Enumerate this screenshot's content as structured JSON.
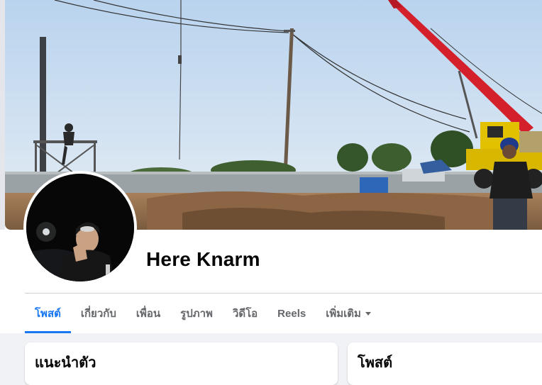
{
  "profile": {
    "name": "Here Knarm"
  },
  "tabs": [
    {
      "label": "โพสต์",
      "active": true
    },
    {
      "label": "เกี่ยวกับ",
      "active": false
    },
    {
      "label": "เพื่อน",
      "active": false
    },
    {
      "label": "รูปภาพ",
      "active": false
    },
    {
      "label": "วิดีโอ",
      "active": false
    },
    {
      "label": "Reels",
      "active": false
    },
    {
      "label": "เพิ่มเติม",
      "active": false,
      "icon": "caret-down-icon"
    }
  ],
  "cards": {
    "intro_title": "แนะนำตัว",
    "posts_title": "โพสต์"
  },
  "colors": {
    "accent": "#1877f2",
    "tab_inactive": "#65676b",
    "page_bg": "#f0f2f5",
    "crane": "#d4202b"
  }
}
